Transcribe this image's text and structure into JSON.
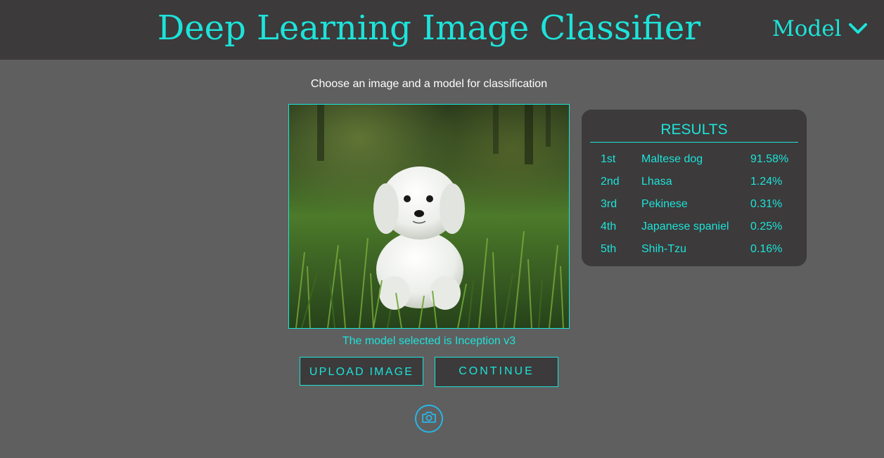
{
  "header": {
    "title": "Deep Learning Image Classifier",
    "model_menu_label": "Model"
  },
  "main": {
    "instruction": "Choose an image and a model for classification",
    "model_status": "The model selected is Inception v3",
    "upload_label": "UPLOAD IMAGE",
    "continue_label": "CONTINUE",
    "camera_icon": "camera-icon"
  },
  "results": {
    "title": "RESULTS",
    "rows": [
      {
        "rank": "1st",
        "label": "Maltese dog",
        "score": "91.58%"
      },
      {
        "rank": "2nd",
        "label": "Lhasa",
        "score": "1.24%"
      },
      {
        "rank": "3rd",
        "label": "Pekinese",
        "score": "0.31%"
      },
      {
        "rank": "4th",
        "label": "Japanese spaniel",
        "score": "0.25%"
      },
      {
        "rank": "5th",
        "label": "Shih-Tzu",
        "score": "0.16%"
      }
    ]
  },
  "colors": {
    "accent": "#1de3da",
    "camera_ring": "#28b6e6",
    "panel": "#3c3a3a",
    "background": "#5f5f5f"
  }
}
